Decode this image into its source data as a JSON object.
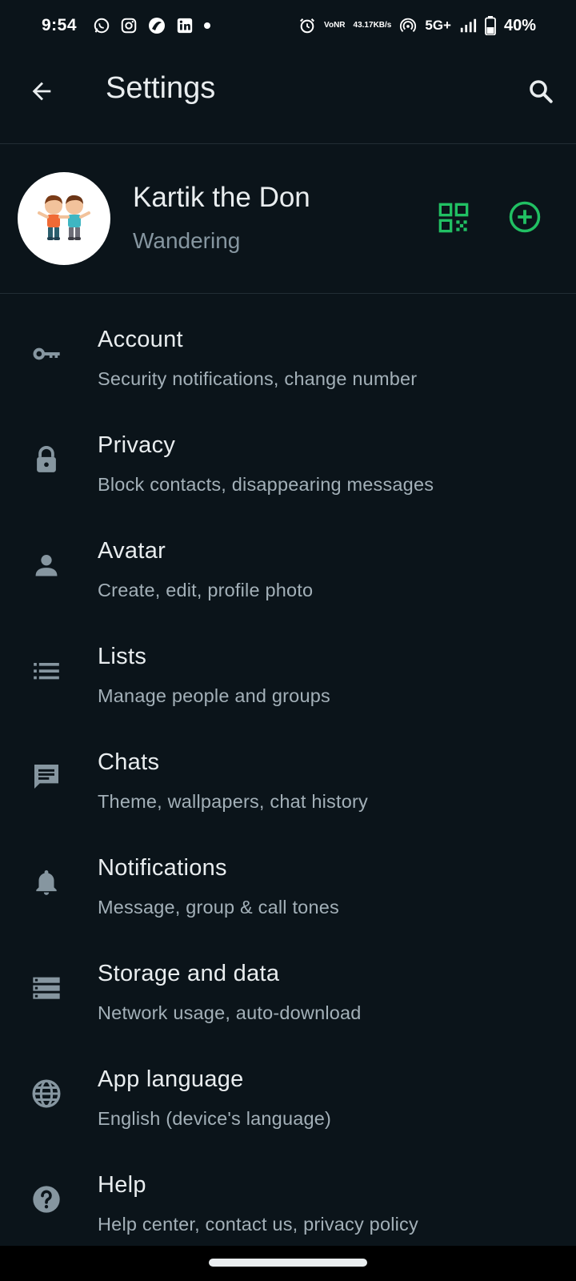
{
  "status_bar": {
    "time": "9:54",
    "net_speed_value": "43.17",
    "net_speed_unit": "KB/s",
    "volte_top": "Vo",
    "volte_bottom": "NR",
    "network": "5G+",
    "battery": "40%"
  },
  "app_bar": {
    "title": "Settings"
  },
  "profile": {
    "name": "Kartik the Don",
    "status": "Wandering"
  },
  "settings_items": [
    {
      "title": "Account",
      "subtitle": "Security notifications, change number",
      "icon": "key-icon"
    },
    {
      "title": "Privacy",
      "subtitle": "Block contacts, disappearing messages",
      "icon": "lock-icon"
    },
    {
      "title": "Avatar",
      "subtitle": "Create, edit, profile photo",
      "icon": "person-icon"
    },
    {
      "title": "Lists",
      "subtitle": "Manage people and groups",
      "icon": "list-icon"
    },
    {
      "title": "Chats",
      "subtitle": "Theme, wallpapers, chat history",
      "icon": "chat-icon"
    },
    {
      "title": "Notifications",
      "subtitle": "Message, group & call tones",
      "icon": "bell-icon"
    },
    {
      "title": "Storage and data",
      "subtitle": "Network usage, auto-download",
      "icon": "storage-icon"
    },
    {
      "title": "App language",
      "subtitle": "English (device's language)",
      "icon": "globe-icon"
    },
    {
      "title": "Help",
      "subtitle": "Help center, contact us, privacy policy",
      "icon": "help-icon"
    }
  ],
  "colors": {
    "background": "#0b141a",
    "accent_green": "#21c063",
    "icon_gray": "#8696a0",
    "text_primary": "#e9edef",
    "text_secondary": "#a3b0b8"
  }
}
